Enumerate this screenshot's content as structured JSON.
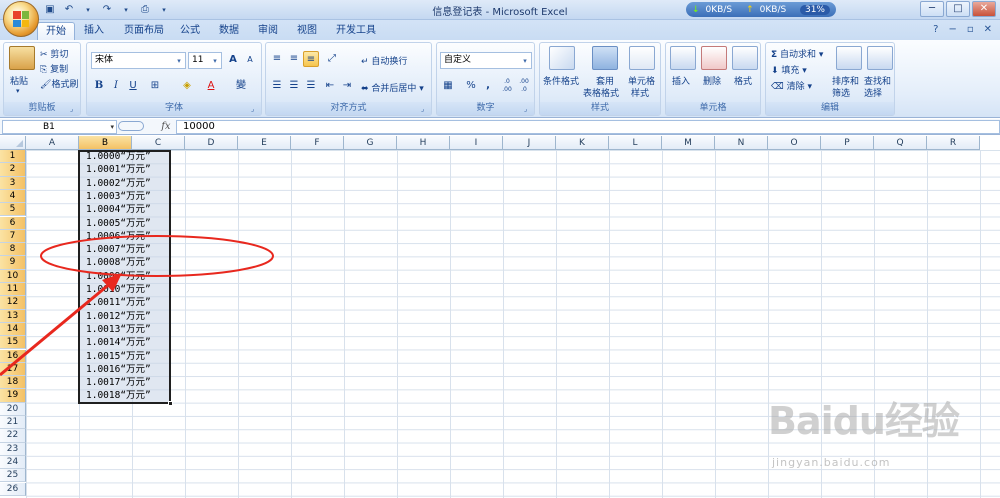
{
  "window": {
    "title": "信息登记表 - Microsoft Excel",
    "net": {
      "down": "0KB/S",
      "up": "0KB/S",
      "percent": "31%"
    },
    "controls": {
      "minimize": "─",
      "maximize": "□",
      "close": "✕"
    }
  },
  "ribbon_tabs": [
    "开始",
    "插入",
    "页面布局",
    "公式",
    "数据",
    "审阅",
    "视图",
    "开发工具"
  ],
  "active_tab": "开始",
  "ribbon": {
    "clipboard": {
      "label": "剪贴板",
      "paste": "粘贴",
      "cut": "剪切",
      "copy": "复制",
      "format_painter": "格式刷"
    },
    "font": {
      "label": "字体",
      "font_name": "宋体",
      "font_size": "11",
      "bold": "B",
      "italic": "I",
      "underline": "U"
    },
    "alignment": {
      "label": "对齐方式",
      "wrap_text": "自动换行",
      "merge_center": "合并后居中"
    },
    "number": {
      "label": "数字",
      "format": "自定义",
      "currency": "%",
      "comma": ",",
      "increase_decimal": ".0 .00",
      "decrease_decimal": ".00 .0"
    },
    "styles": {
      "label": "样式",
      "conditional": "条件格式",
      "as_table_1": "套用",
      "as_table_2": "表格格式",
      "cell_styles_1": "单元格",
      "cell_styles_2": "样式"
    },
    "cells": {
      "label": "单元格",
      "insert": "插入",
      "delete": "删除",
      "format": "格式"
    },
    "editing": {
      "label": "编辑",
      "autosum": "自动求和",
      "fill": "填充",
      "clear": "清除",
      "sort_1": "排序和",
      "sort_2": "筛选",
      "find_1": "查找和",
      "find_2": "选择"
    }
  },
  "formula_bar": {
    "name_box": "B1",
    "fx": "fx",
    "value": "10000"
  },
  "columns": [
    "A",
    "B",
    "C",
    "D",
    "E",
    "F",
    "G",
    "H",
    "I",
    "J",
    "K",
    "L",
    "M",
    "N",
    "O",
    "P",
    "Q",
    "R"
  ],
  "rows": [
    "1",
    "2",
    "3",
    "4",
    "5",
    "6",
    "7",
    "8",
    "9",
    "10",
    "11",
    "12",
    "13",
    "14",
    "15",
    "16",
    "17",
    "18",
    "19",
    "20",
    "21",
    "22",
    "23",
    "24",
    "25",
    "26"
  ],
  "selected_column": "B",
  "cells_b": [
    "1.0000“万元”",
    "1.0001“万元”",
    "1.0002“万元”",
    "1.0003“万元”",
    "1.0004“万元”",
    "1.0005“万元”",
    "1.0006“万元”",
    "1.0007“万元”",
    "1.0008“万元”",
    "1.0009“万元”",
    "1.0010“万元”",
    "1.0011“万元”",
    "1.0012“万元”",
    "1.0013“万元”",
    "1.0014“万元”",
    "1.0015“万元”",
    "1.0016“万元”",
    "1.0017“万元”",
    "1.0018“万元”"
  ],
  "watermark": {
    "brand": "Baidu经验",
    "url": "jingyan.baidu.com"
  },
  "colors": {
    "annotation": "#e8281e",
    "selection_border": "#1f1f1f",
    "header_selected": "#f4c165"
  }
}
